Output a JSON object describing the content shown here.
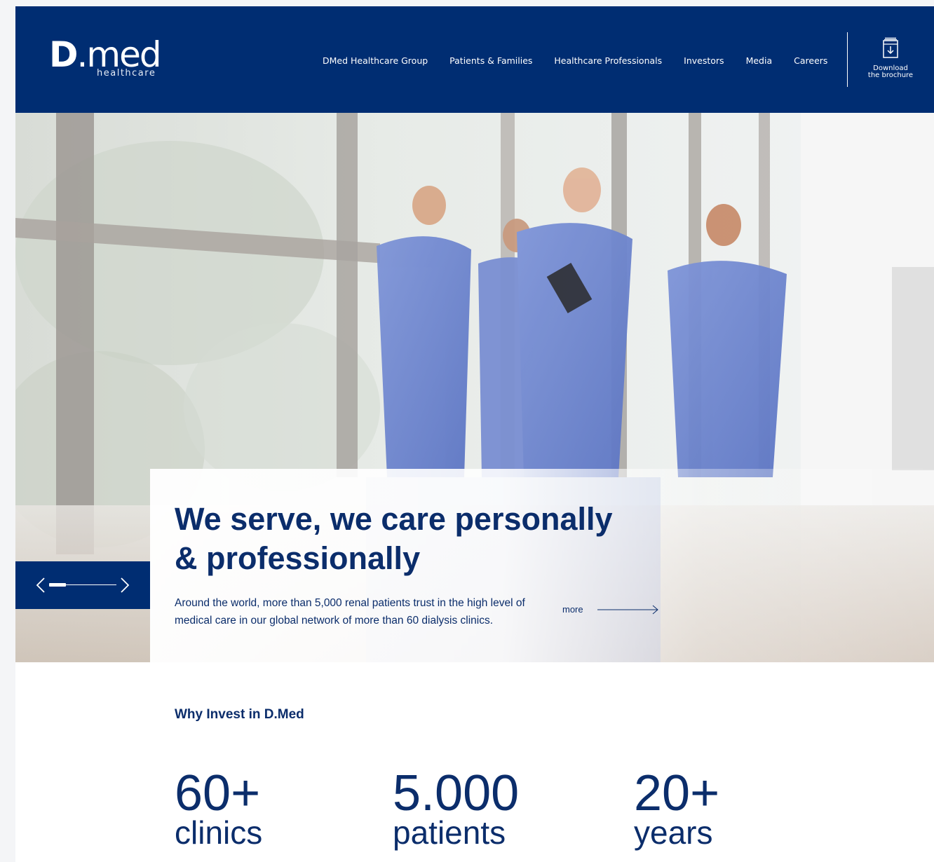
{
  "colors": {
    "brand": "#002d72",
    "text_dark": "#0b2d6b",
    "white": "#ffffff"
  },
  "header": {
    "logo": {
      "main_d": "D",
      "main_rest": ".med",
      "sub": "healthcare"
    },
    "nav": [
      {
        "label": "DMed Healthcare Group"
      },
      {
        "label": "Patients & Families"
      },
      {
        "label": "Healthcare Professionals"
      },
      {
        "label": "Investors"
      },
      {
        "label": "Media"
      },
      {
        "label": "Careers"
      }
    ],
    "brochure": {
      "label": "Download\nthe brochure",
      "icon": "download-document-icon"
    }
  },
  "hero": {
    "title": "We serve, we care personally\n& professionally",
    "description": "Around the world, more than 5,000 renal patients trust in the high level of medical care in our global network of more than 60 dialysis clinics.",
    "more_label": "more",
    "slider": {
      "prev_icon": "chevron-left-icon",
      "next_icon": "chevron-right-icon",
      "progress": 0.25
    }
  },
  "why_invest": {
    "heading": "Why Invest in D.Med",
    "stats": [
      {
        "number": "60+",
        "label": "clinics"
      },
      {
        "number": "5.000",
        "label": "patients"
      },
      {
        "number": "20+",
        "label": "years"
      }
    ]
  }
}
